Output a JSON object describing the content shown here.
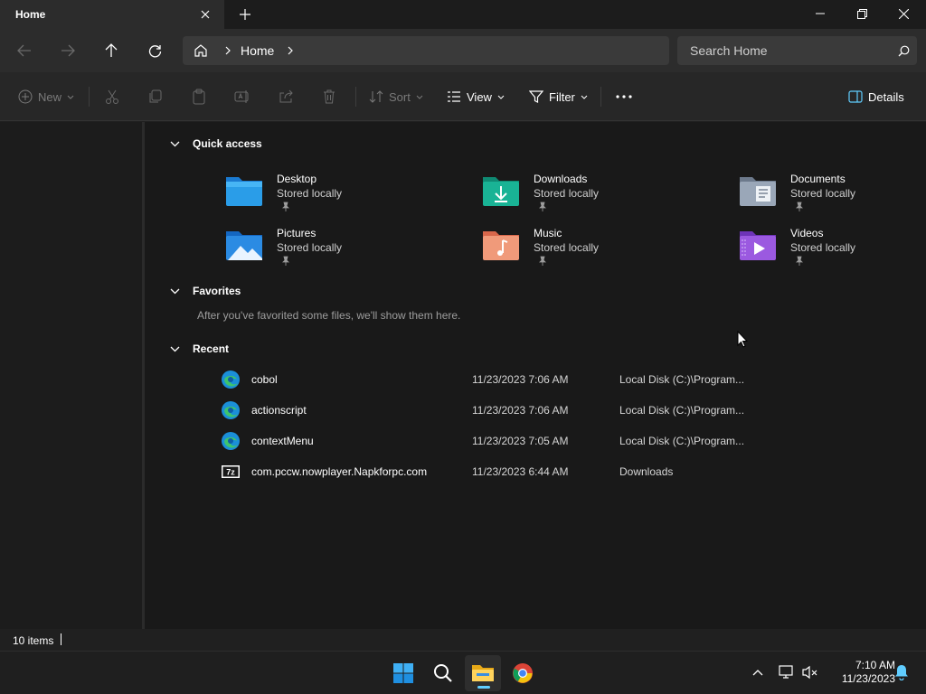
{
  "window": {
    "tab_title": "Home",
    "new_tab_label": "+"
  },
  "navigation": {
    "breadcrumb": [
      "Home"
    ],
    "search_placeholder": "Search Home"
  },
  "command_bar": {
    "new_label": "New",
    "sort_label": "Sort",
    "view_label": "View",
    "filter_label": "Filter",
    "details_label": "Details"
  },
  "quick_access": {
    "heading": "Quick access",
    "items": [
      {
        "name": "Desktop",
        "sub": "Stored locally",
        "icon": "desktop-folder-icon"
      },
      {
        "name": "Downloads",
        "sub": "Stored locally",
        "icon": "downloads-folder-icon"
      },
      {
        "name": "Documents",
        "sub": "Stored locally",
        "icon": "documents-folder-icon"
      },
      {
        "name": "Pictures",
        "sub": "Stored locally",
        "icon": "pictures-folder-icon"
      },
      {
        "name": "Music",
        "sub": "Stored locally",
        "icon": "music-folder-icon"
      },
      {
        "name": "Videos",
        "sub": "Stored locally",
        "icon": "videos-folder-icon"
      }
    ]
  },
  "favorites": {
    "heading": "Favorites",
    "empty_text": "After you've favorited some files, we'll show them here."
  },
  "recent": {
    "heading": "Recent",
    "items": [
      {
        "name": "cobol",
        "date": "11/23/2023 7:06 AM",
        "location": "Local Disk (C:)\\Program...",
        "icon": "edge-icon"
      },
      {
        "name": "actionscript",
        "date": "11/23/2023 7:06 AM",
        "location": "Local Disk (C:)\\Program...",
        "icon": "edge-icon"
      },
      {
        "name": "contextMenu",
        "date": "11/23/2023 7:05 AM",
        "location": "Local Disk (C:)\\Program...",
        "icon": "edge-icon"
      },
      {
        "name": "com.pccw.nowplayer.Napkforpc.com",
        "date": "11/23/2023 6:44 AM",
        "location": "Downloads",
        "icon": "7zip-icon"
      }
    ]
  },
  "status": {
    "item_count": "10 items"
  },
  "taskbar": {
    "time": "7:10 AM",
    "date": "11/23/2023"
  },
  "colors": {
    "accent": "#60cdff",
    "background": "#191919"
  }
}
